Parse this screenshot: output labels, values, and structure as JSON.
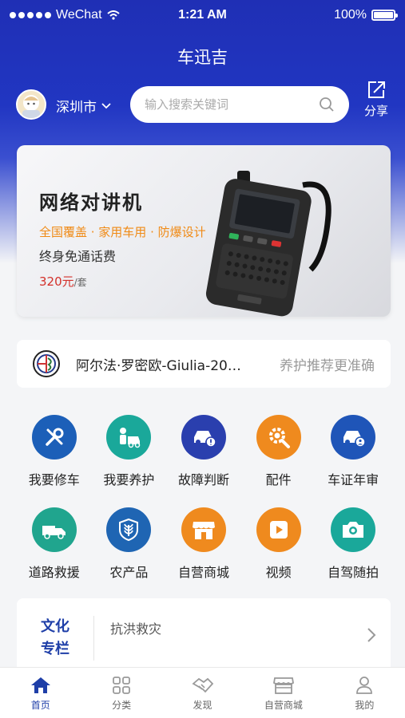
{
  "status_bar": {
    "carrier": "WeChat",
    "time": "1:21 AM",
    "battery": "100%",
    "battery_level": 1.0
  },
  "nav": {
    "title": "车迅吉"
  },
  "topbar": {
    "city": "深圳市",
    "search_placeholder": "输入搜索关键词",
    "share_label": "分享"
  },
  "banner": {
    "title": "网络对讲机",
    "features": "全国覆盖 · 家用车用 · 防爆设计",
    "subtitle": "终身免通话费",
    "price": "320元",
    "price_unit": "/套"
  },
  "car": {
    "name": "阿尔法·罗密欧-Giulia-20…",
    "tip": "养护推荐更准确"
  },
  "services": [
    {
      "label": "我要修车",
      "icon": "wrench-screwdriver-icon",
      "color": "#1c5fb8"
    },
    {
      "label": "我要养护",
      "icon": "car-maintenance-icon",
      "color": "#1aa89a"
    },
    {
      "label": "故障判断",
      "icon": "car-fault-icon",
      "color": "#2a3fae"
    },
    {
      "label": "配件",
      "icon": "gear-wrench-icon",
      "color": "#ef8a1e"
    },
    {
      "label": "车证年审",
      "icon": "car-certificate-icon",
      "color": "#1f55b8"
    },
    {
      "label": "道路救援",
      "icon": "tow-truck-icon",
      "color": "#20a58e"
    },
    {
      "label": "农产品",
      "icon": "wheat-shield-icon",
      "color": "#1f65b3"
    },
    {
      "label": "自营商城",
      "icon": "store-icon",
      "color": "#ef8a1e"
    },
    {
      "label": "视频",
      "icon": "play-icon",
      "color": "#ef8a1e"
    },
    {
      "label": "自驾随拍",
      "icon": "camera-icon",
      "color": "#1aa89a"
    }
  ],
  "culture": {
    "label_line1": "文化",
    "label_line2": "专栏",
    "text": "抗洪救灾"
  },
  "tabs": [
    {
      "label": "首页",
      "icon": "home-icon"
    },
    {
      "label": "分类",
      "icon": "grid-icon"
    },
    {
      "label": "发现",
      "icon": "handshake-icon"
    },
    {
      "label": "自营商城",
      "icon": "shop-icon"
    },
    {
      "label": "我的",
      "icon": "user-icon"
    }
  ],
  "colors": {
    "primary": "#1f2fb5",
    "accent": "#f08a15",
    "price": "#d3302a",
    "active_tab": "#1f3fa8"
  }
}
